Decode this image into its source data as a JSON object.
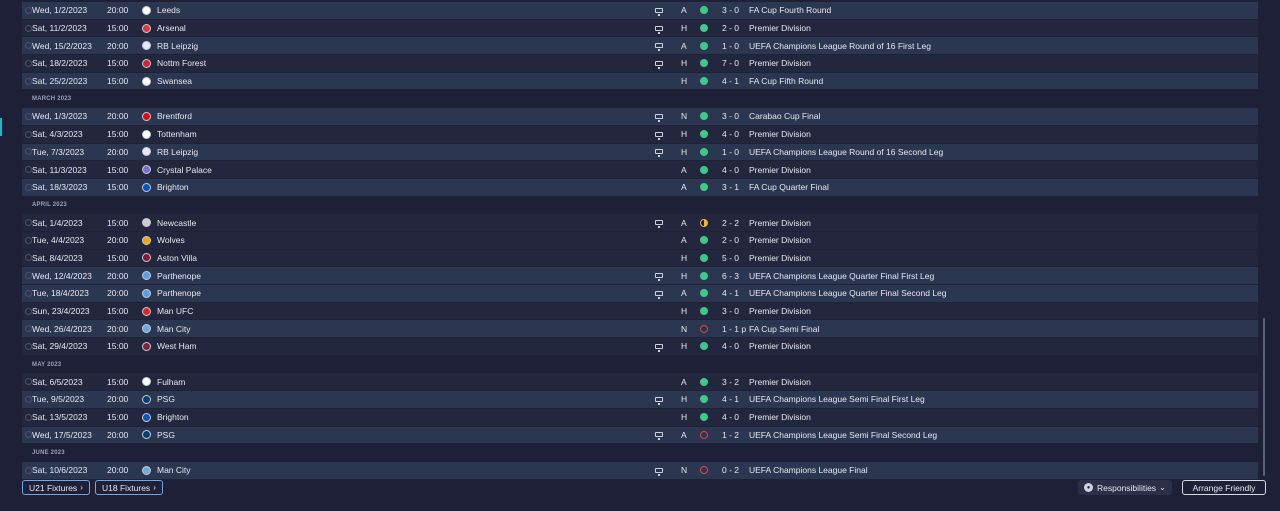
{
  "colors": {
    "accent": "#1fb6c9",
    "win": "#3ec98a",
    "draw": "#f0b23a",
    "loss": "#e0443f",
    "row_alt": "#2b3651"
  },
  "rows": [
    {
      "type": "fixture",
      "date": "Wed, 1/2/2023",
      "time": "20:00",
      "team": "Leeds",
      "tv": true,
      "venue": "A",
      "result": "win",
      "score": "3 - 0",
      "competition": "FA Cup Fourth Round",
      "crest_color": "#ffffff",
      "alt": true
    },
    {
      "type": "fixture",
      "date": "Sat, 11/2/2023",
      "time": "15:00",
      "team": "Arsenal",
      "tv": true,
      "venue": "H",
      "result": "win",
      "score": "2 - 0",
      "competition": "Premier Division",
      "crest_color": "#e03a3e",
      "alt": false
    },
    {
      "type": "fixture",
      "date": "Wed, 15/2/2023",
      "time": "20:00",
      "team": "RB Leipzig",
      "tv": true,
      "venue": "A",
      "result": "win",
      "score": "1 - 0",
      "competition": "UEFA Champions League Round of 16  First Leg",
      "crest_color": "#e8e8f0",
      "alt": true
    },
    {
      "type": "fixture",
      "date": "Sat, 18/2/2023",
      "time": "15:00",
      "team": "Nottm Forest",
      "tv": true,
      "venue": "H",
      "result": "win",
      "score": "7 - 0",
      "competition": "Premier Division",
      "crest_color": "#d6232b",
      "alt": false
    },
    {
      "type": "fixture",
      "date": "Sat, 25/2/2023",
      "time": "15:00",
      "team": "Swansea",
      "tv": false,
      "venue": "H",
      "result": "win",
      "score": "4 - 1",
      "competition": "FA Cup Fifth Round",
      "crest_color": "#ffffff",
      "alt": true
    },
    {
      "type": "month",
      "label": "MARCH 2023"
    },
    {
      "type": "fixture",
      "date": "Wed, 1/3/2023",
      "time": "20:00",
      "team": "Brentford",
      "tv": true,
      "venue": "N",
      "result": "win",
      "score": "3 - 0",
      "competition": "Carabao Cup Final",
      "crest_color": "#e30613",
      "alt": true
    },
    {
      "type": "fixture",
      "date": "Sat, 4/3/2023",
      "time": "15:00",
      "team": "Tottenham",
      "tv": true,
      "venue": "H",
      "result": "win",
      "score": "4 - 0",
      "competition": "Premier Division",
      "crest_color": "#ffffff",
      "alt": false
    },
    {
      "type": "fixture",
      "date": "Tue, 7/3/2023",
      "time": "20:00",
      "team": "RB Leipzig",
      "tv": true,
      "venue": "H",
      "result": "win",
      "score": "1 - 0",
      "competition": "UEFA Champions League Round of 16  Second Leg",
      "crest_color": "#e8e8f0",
      "alt": true
    },
    {
      "type": "fixture",
      "date": "Sat, 11/3/2023",
      "time": "15:00",
      "team": "Crystal Palace",
      "tv": false,
      "venue": "A",
      "result": "win",
      "score": "4 - 0",
      "competition": "Premier Division",
      "crest_color": "#7b6fd0",
      "alt": false
    },
    {
      "type": "fixture",
      "date": "Sat, 18/3/2023",
      "time": "15:00",
      "team": "Brighton",
      "tv": false,
      "venue": "A",
      "result": "win",
      "score": "3 - 1",
      "competition": "FA Cup Quarter Final",
      "crest_color": "#0057b8",
      "alt": true
    },
    {
      "type": "month",
      "label": "APRIL 2023"
    },
    {
      "type": "fixture",
      "date": "Sat, 1/4/2023",
      "time": "15:00",
      "team": "Newcastle",
      "tv": true,
      "venue": "A",
      "result": "draw",
      "score": "2 - 2",
      "competition": "Premier Division",
      "crest_color": "#cccccc",
      "alt": false
    },
    {
      "type": "fixture",
      "date": "Tue, 4/4/2023",
      "time": "20:00",
      "team": "Wolves",
      "tv": false,
      "venue": "A",
      "result": "win",
      "score": "2 - 0",
      "competition": "Premier Division",
      "crest_color": "#f2a900",
      "alt": false
    },
    {
      "type": "fixture",
      "date": "Sat, 8/4/2023",
      "time": "15:00",
      "team": "Aston Villa",
      "tv": false,
      "venue": "H",
      "result": "win",
      "score": "5 - 0",
      "competition": "Premier Division",
      "crest_color": "#8a1538",
      "alt": false
    },
    {
      "type": "fixture",
      "date": "Wed, 12/4/2023",
      "time": "20:00",
      "team": "Parthenope",
      "tv": true,
      "venue": "H",
      "result": "win",
      "score": "6 - 3",
      "competition": "UEFA Champions League Quarter Final First Leg",
      "crest_color": "#5aa0e0",
      "alt": true
    },
    {
      "type": "fixture",
      "date": "Tue, 18/4/2023",
      "time": "20:00",
      "team": "Parthenope",
      "tv": true,
      "venue": "A",
      "result": "win",
      "score": "4 - 1",
      "competition": "UEFA Champions League Quarter Final Second Leg",
      "crest_color": "#5aa0e0",
      "alt": true
    },
    {
      "type": "fixture",
      "date": "Sun, 23/4/2023",
      "time": "15:00",
      "team": "Man UFC",
      "tv": false,
      "venue": "H",
      "result": "win",
      "score": "3 - 0",
      "competition": "Premier Division",
      "crest_color": "#da291c",
      "alt": false
    },
    {
      "type": "fixture",
      "date": "Wed, 26/4/2023",
      "time": "20:00",
      "team": "Man City",
      "tv": false,
      "venue": "N",
      "result": "loss",
      "score": "1 - 1 p",
      "competition": "FA Cup Semi Final",
      "crest_color": "#6cabdd",
      "alt": true
    },
    {
      "type": "fixture",
      "date": "Sat, 29/4/2023",
      "time": "15:00",
      "team": "West Ham",
      "tv": true,
      "venue": "H",
      "result": "win",
      "score": "4 - 0",
      "competition": "Premier Division",
      "crest_color": "#7a263a",
      "alt": false
    },
    {
      "type": "month",
      "label": "MAY 2023"
    },
    {
      "type": "fixture",
      "date": "Sat, 6/5/2023",
      "time": "15:00",
      "team": "Fulham",
      "tv": false,
      "venue": "A",
      "result": "win",
      "score": "3 - 2",
      "competition": "Premier Division",
      "crest_color": "#ffffff",
      "alt": false
    },
    {
      "type": "fixture",
      "date": "Tue, 9/5/2023",
      "time": "20:00",
      "team": "PSG",
      "tv": true,
      "venue": "H",
      "result": "win",
      "score": "4 - 1",
      "competition": "UEFA Champions League Semi Final First Leg",
      "crest_color": "#004170",
      "alt": true
    },
    {
      "type": "fixture",
      "date": "Sat, 13/5/2023",
      "time": "15:00",
      "team": "Brighton",
      "tv": false,
      "venue": "H",
      "result": "win",
      "score": "4 - 0",
      "competition": "Premier Division",
      "crest_color": "#0057b8",
      "alt": false
    },
    {
      "type": "fixture",
      "date": "Wed, 17/5/2023",
      "time": "20:00",
      "team": "PSG",
      "tv": true,
      "venue": "A",
      "result": "loss",
      "score": "1 - 2",
      "competition": "UEFA Champions League Semi Final Second Leg",
      "crest_color": "#004170",
      "alt": true
    },
    {
      "type": "month",
      "label": "JUNE 2023"
    },
    {
      "type": "fixture",
      "date": "Sat, 10/6/2023",
      "time": "20:00",
      "team": "Man City",
      "tv": true,
      "venue": "N",
      "result": "loss",
      "score": "0 - 2",
      "competition": "UEFA Champions League Final",
      "crest_color": "#6cabdd",
      "alt": true
    }
  ],
  "footer": {
    "u21_label": "U21 Fixtures",
    "u18_label": "U18 Fixtures",
    "responsibilities_label": "Responsibilities",
    "arrange_friendly_label": "Arrange Friendly"
  }
}
